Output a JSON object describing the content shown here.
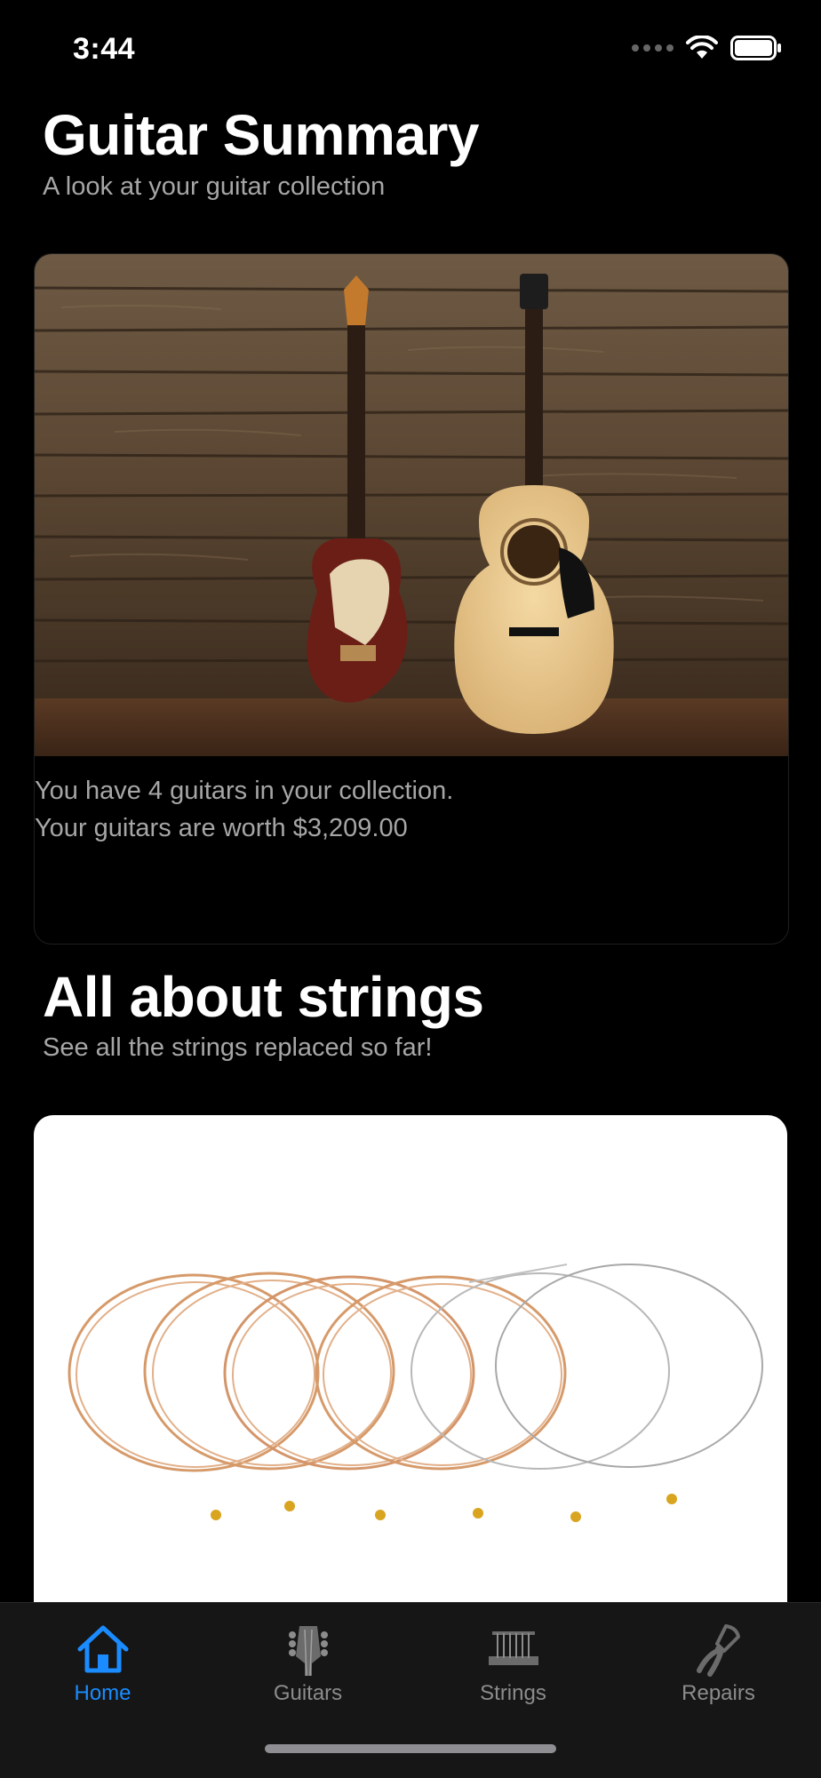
{
  "status": {
    "time": "3:44"
  },
  "summary": {
    "title": "Guitar Summary",
    "subtitle": "A look at your guitar collection",
    "count_text": "You have 4 guitars in your collection.",
    "worth_text": "Your guitars are worth $3,209.00"
  },
  "strings_section": {
    "title": "All about strings",
    "subtitle": "See all the strings replaced so far!"
  },
  "tabs": [
    {
      "label": "Home",
      "icon": "house-icon",
      "active": true
    },
    {
      "label": "Guitars",
      "icon": "guitar-headstock-icon",
      "active": false
    },
    {
      "label": "Strings",
      "icon": "strings-icon",
      "active": false
    },
    {
      "label": "Repairs",
      "icon": "pliers-icon",
      "active": false
    }
  ],
  "colors": {
    "accent": "#1a8cff",
    "inactive": "#8c8c8c",
    "background": "#000000",
    "tab_bar": "#161616"
  }
}
